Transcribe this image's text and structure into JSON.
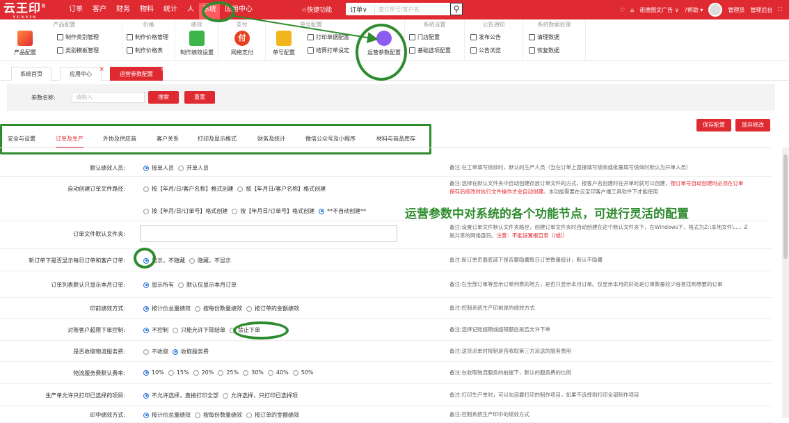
{
  "app": {
    "logo": "云王印",
    "logo_reg": "®",
    "logo_sub": "YUNYIN"
  },
  "nav": [
    "订单",
    "客户",
    "财务",
    "物料",
    "统计",
    "人",
    "系统",
    "应用中心"
  ],
  "topbar": {
    "quick": "☆快捷功能",
    "order_select": "订单∨",
    "search_placeholder": "查订单号/客户名",
    "company": "诺德图文广告 ∨",
    "help": "?帮助 ▾",
    "admin": "管理员",
    "backend": "管理后台"
  },
  "ribbon": {
    "groups": [
      "产品配置",
      "价格",
      "绩效",
      "支付",
      "单号配置",
      "系统设置",
      "公告通知",
      "系统数据处理"
    ],
    "product_config": "产品配置",
    "cat_manage": "制作类别管理",
    "cat_template": "类别模板管理",
    "price_manage": "制作价格管理",
    "price_table": "制作价格表",
    "perf_setting": "制作绩效设置",
    "pay": "网络支付",
    "order_no": "单号配置",
    "print_config": "打印单据配置",
    "checkout_print": "结算打单设定",
    "ops_param": "运营参数配置",
    "store_config": "门店配置",
    "basic_options": "基础选项配置",
    "publish_notice": "发布公告",
    "browse_notice": "公告浏览",
    "clear_data": "清理数据",
    "restore_data": "恢复数据"
  },
  "pagetabs": [
    "系统首页",
    "应用中心",
    "运营参数配置"
  ],
  "filter": {
    "label": "参数名称:",
    "placeholder": "请输入",
    "search": "搜索",
    "reset": "重置"
  },
  "actions": {
    "save": "保存配置",
    "discard": "放弃修改"
  },
  "cattabs": [
    "安全与设置",
    "订单及生产",
    "外协及供应商",
    "客户关系",
    "打印及显示格式",
    "财务及统计",
    "微信公众号及小程序",
    "材料与商品库存"
  ],
  "annotation": "运营参数中对系统的各个功能节点，可进行灵活的配置",
  "rows": [
    {
      "label": "默认绩效人员:",
      "opts": [
        "接单人员",
        "开单人员"
      ],
      "on": 0,
      "note": "备注:在工单填写绩效时，默认的生产人员（当在订单上直接填写绩效或批量填写绩效时默认为开单人员）"
    },
    {
      "label": "自动创建订单文件路径:",
      "opts": [
        "按【年月/日/客户名称】格式创建",
        "按【年月日/客户名称】格式创建"
      ],
      "opts2": [
        "按【年月/日/订单号】格式创建",
        "按【年月日/订单号】格式创建",
        "**不自动创建**"
      ],
      "on2": 2,
      "note": "备注:选择在默认文件夹中自动创建存放订单文件的方式，按客户名创建时在开单时就可以创建，",
      "note_red": "按订单号自动创建时必须在订单保存后修改时执行文件操作才会自动创建。",
      "note2": "本功能需要在云宝印客户端工具软件下才能使用"
    },
    {
      "label": "订单文件默认文件夹:",
      "note": "备注:设置订单文件默认文件夹路径，创建订单文件夹时自动创建在这个默认文件夹下，在Windows下，格式为Z:\\本地文件\\...，Z是共享的网络盘符。",
      "note_red": "注意：不能设置根目录（/或\\）"
    },
    {
      "label": "新订单下是否显示每日订单和客户订单:",
      "opts": [
        "显示，不隐藏",
        "隐藏，不显示"
      ],
      "on": 0,
      "note": "备注:新订单页面底部下是否要隐藏每日订单数量统计，默认不隐藏"
    },
    {
      "label": "订单列表默认只显示本月订单:",
      "opts": [
        "显示所有",
        "默认仅显示本月订单"
      ],
      "on": 0,
      "note": "备注:在全部订单等显示订单列表的地方，是否只显示本月订单。仅显示本月的好处是订单数量较少容易找到想要的订单"
    },
    {
      "label": "印前绩效方式:",
      "opts": [
        "按计价总量绩效",
        "按每份数量绩效",
        "按订单的金额绩效"
      ],
      "on": 0,
      "note": "备注:控制系统生产印前是的绩效方式"
    },
    {
      "label": "对账客户超限下单控制:",
      "opts": [
        "不控制",
        "只能允许下现结单",
        "禁止下单"
      ],
      "on": 0,
      "note": "备注:选择记账超期或超限额后是否允许下单"
    },
    {
      "label": "是否收取物流服务费:",
      "opts": [
        "不收取",
        "收取服务费"
      ],
      "on": 1,
      "note": "备注:送货派单时按制是否收取第三方派送的服务费用"
    },
    {
      "label": "物流服务费默认费率:",
      "opts": [
        "10%",
        "15%",
        "20%",
        "25%",
        "30%",
        "40%",
        "50%"
      ],
      "on": 0,
      "note": "备注:在收取物流服务的前提下，默认的服务费的比例"
    },
    {
      "label": "生产单允许只打印已选择的项目:",
      "opts": [
        "不允许选择，直接打印全部",
        "允许选择，只打印已选择项"
      ],
      "on": 0,
      "note": "备注:打印生产单时，可以勾选要打印的制作项目，如果不选择则打印全部制作项目"
    },
    {
      "label": "印中绩效方式:",
      "opts": [
        "按计价总量绩效",
        "按每份数量绩效",
        "按订单的金额绩效"
      ],
      "on": 0,
      "note": "备注:控制系统生产印中的绩效方式"
    }
  ]
}
